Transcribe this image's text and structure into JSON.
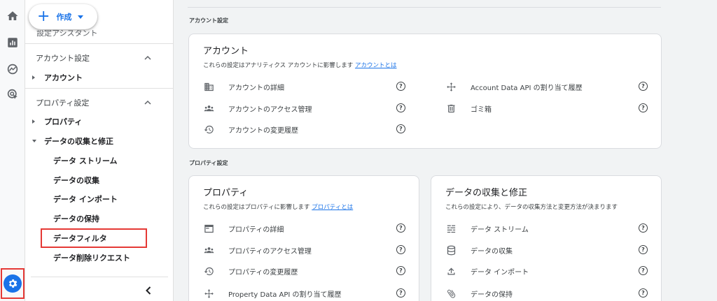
{
  "create_button": {
    "label": "作成"
  },
  "sidebar": {
    "peek_text": "設定アシスタント",
    "account_section": "アカウント設定",
    "account_item": "アカウント",
    "property_section": "プロパティ設定",
    "property_item": "プロパティ",
    "data_collection_item": "データの収集と修正",
    "sub_items": [
      "データ ストリーム",
      "データの収集",
      "データ インポート",
      "データの保持",
      "データフィルタ",
      "データ削除リクエスト"
    ]
  },
  "main": {
    "account_group_label": "アカウント設定",
    "account_card": {
      "title": "アカウント",
      "desc": "これらの設定はアナリティクス アカウントに影響します",
      "link": "アカウントとは",
      "left_rows": [
        {
          "icon": "building-icon",
          "label": "アカウントの詳細"
        },
        {
          "icon": "people-icon",
          "label": "アカウントのアクセス管理"
        },
        {
          "icon": "history-icon",
          "label": "アカウントの変更履歴"
        }
      ],
      "right_rows": [
        {
          "icon": "move-icon",
          "label": "Account Data API の割り当て履歴"
        },
        {
          "icon": "trash-icon",
          "label": "ゴミ箱"
        }
      ]
    },
    "property_group_label": "プロパティ設定",
    "property_card": {
      "title": "プロパティ",
      "desc": "これらの設定はプロパティに影響します",
      "link": "プロパティとは",
      "rows": [
        {
          "icon": "window-icon",
          "label": "プロパティの詳細"
        },
        {
          "icon": "people-icon",
          "label": "プロパティのアクセス管理"
        },
        {
          "icon": "history-icon",
          "label": "プロパティの変更履歴"
        },
        {
          "icon": "move-icon",
          "label": "Property Data API の割り当て履歴"
        }
      ]
    },
    "data_card": {
      "title": "データの収集と修正",
      "desc": "これらの設定により、データの収集方法と変更方法が決まります",
      "rows": [
        {
          "icon": "streams-icon",
          "label": "データ ストリーム"
        },
        {
          "icon": "database-icon",
          "label": "データの収集"
        },
        {
          "icon": "upload-icon",
          "label": "データ インポート"
        },
        {
          "icon": "attach-icon",
          "label": "データの保持"
        }
      ]
    }
  },
  "colors": {
    "accent": "#1a73e8",
    "highlight": "#e53935"
  }
}
